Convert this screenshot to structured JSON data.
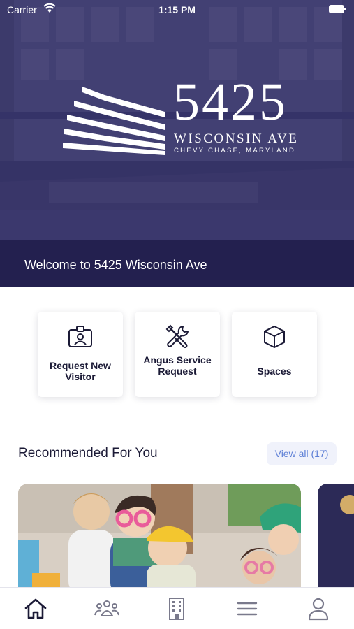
{
  "status_bar": {
    "carrier": "Carrier",
    "time": "1:15 PM"
  },
  "hero": {
    "logo_number": "5425",
    "logo_street": "WISCONSIN AVE",
    "logo_city": "CHEVY CHASE, MARYLAND",
    "welcome": "Welcome to 5425 Wisconsin Ave"
  },
  "actions": [
    {
      "label": "Request New Visitor",
      "icon": "visitor-badge-icon"
    },
    {
      "label": "Angus Service Request",
      "icon": "tools-icon"
    },
    {
      "label": "Spaces",
      "icon": "cube-icon"
    }
  ],
  "recommended": {
    "title": "Recommended For You",
    "view_all": "View all (17)"
  },
  "tabbar": {
    "items": [
      "home-icon",
      "community-icon",
      "building-icon",
      "menu-icon",
      "profile-icon"
    ]
  },
  "colors": {
    "brand_navy": "#23204f",
    "text": "#1b1a36",
    "link": "#5d7fd6"
  }
}
